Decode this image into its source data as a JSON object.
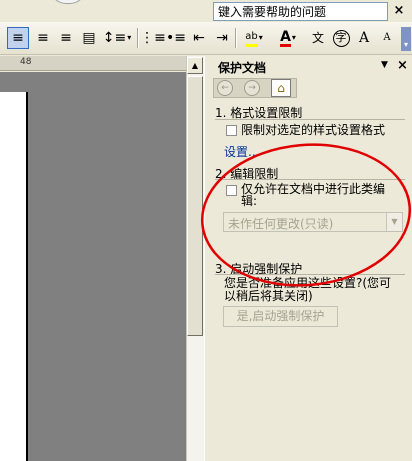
{
  "help": {
    "placeholder": "键入需要帮助的问题",
    "close": "×"
  },
  "toolbar": {
    "more": "▾",
    "buttons": [
      {
        "name": "justify",
        "glyph": "≡"
      },
      {
        "name": "align-center",
        "glyph": "≡"
      },
      {
        "name": "align-right",
        "glyph": "≡"
      },
      {
        "name": "distributed",
        "glyph": "▤"
      },
      {
        "name": "line-spacing",
        "glyph": "↕≡"
      },
      {
        "name": "numbering",
        "glyph": "⋮≡"
      },
      {
        "name": "bullets",
        "glyph": "•≡"
      },
      {
        "name": "decrease-indent",
        "glyph": "⇤"
      },
      {
        "name": "increase-indent",
        "glyph": "⇥"
      },
      {
        "name": "highlight",
        "glyph": "ab"
      },
      {
        "name": "font-color",
        "glyph": "A"
      },
      {
        "name": "phonetic",
        "glyph": "文"
      },
      {
        "name": "enclose",
        "glyph": "字"
      },
      {
        "name": "grow-font",
        "glyph": "A"
      },
      {
        "name": "shrink-font",
        "glyph": "A"
      }
    ]
  },
  "ruler": {
    "mark": "48"
  },
  "pane": {
    "title": "保护文档",
    "menu": "▼",
    "close": "×",
    "nav": {
      "back": "←",
      "forward": "→",
      "home": "⌂"
    },
    "section1": {
      "title": "1. 格式设置限制",
      "checkbox_label": "限制对选定的样式设置格式",
      "link": "设置..."
    },
    "section2": {
      "title": "2. 编辑限制",
      "checkbox_label_line1": "仅允许在文档中进行此类编",
      "checkbox_label_line2": "辑:",
      "select_value": "未作任何更改(只读)",
      "select_arrow": "▼"
    },
    "section3": {
      "title": "3. 启动强制保护",
      "prompt_line1": "您是否准备应用这些设置?(您可",
      "prompt_line2": "以稍后将其关闭)",
      "button": "是,启动强制保护"
    }
  },
  "colors": {
    "annotation": "#e00000",
    "link": "#003399",
    "disabled_text": "#a7a391"
  }
}
